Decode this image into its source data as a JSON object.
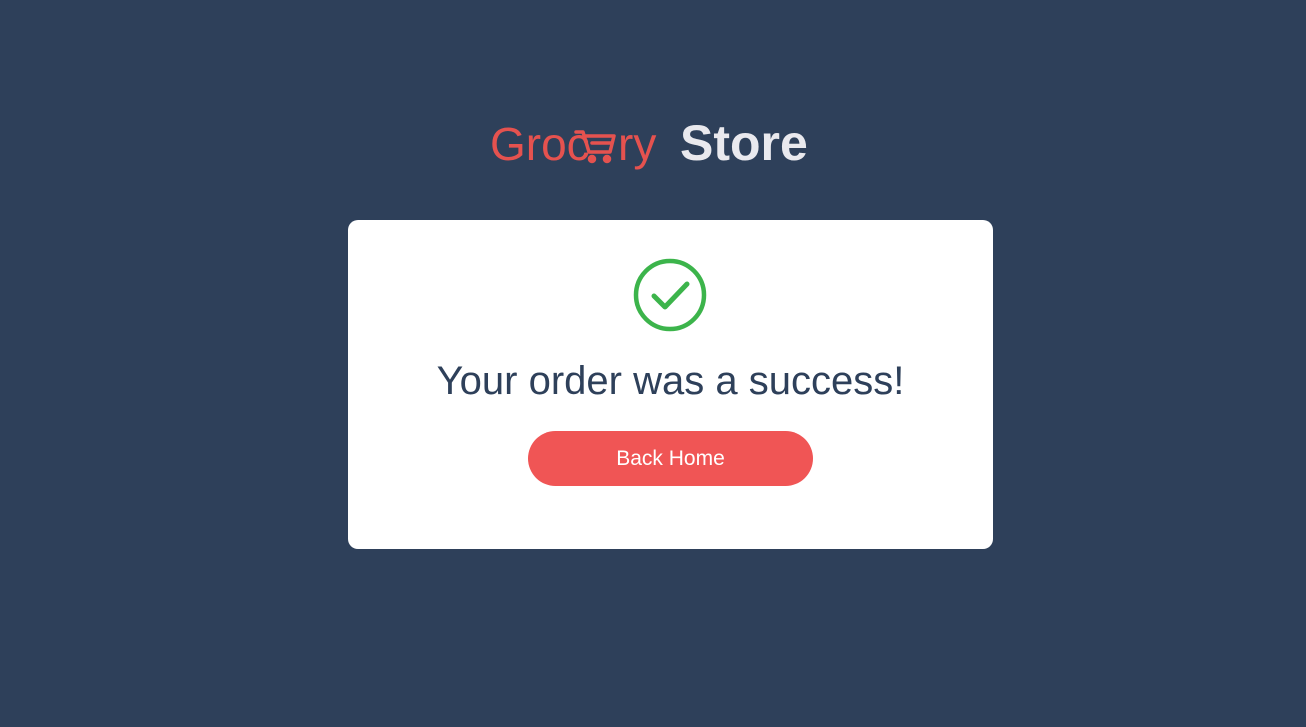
{
  "logo": {
    "brand_text_part1": "Groc",
    "brand_cart_icon": "shopping-cart-icon",
    "brand_text_part2": "ry",
    "brand_text_part3": "Store"
  },
  "success_card": {
    "status_icon": "checkmark-circle-icon",
    "message": "Your order was a success!",
    "button_label": "Back Home"
  },
  "colors": {
    "background": "#2e405a",
    "brand_red": "#f05555",
    "success_green": "#3cb44b",
    "card": "#ffffff",
    "logo_store_text": "#e9e9ee"
  }
}
